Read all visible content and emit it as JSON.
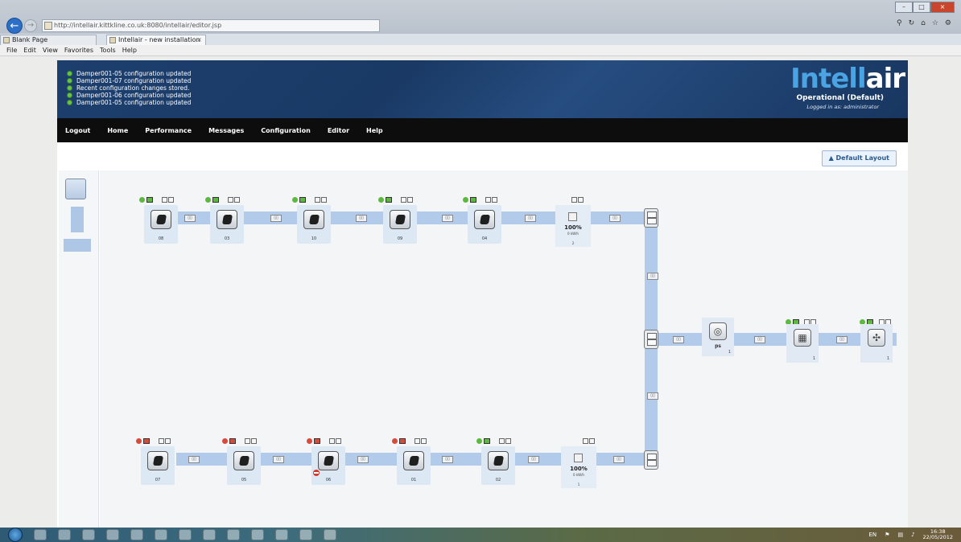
{
  "browser": {
    "url": "http://intellair.kittkline.co.uk:8080/intellair/editor.jsp",
    "tabs": [
      {
        "label": "Blank Page"
      },
      {
        "label": "Intellair - new installation"
      }
    ],
    "menu": [
      "File",
      "Edit",
      "View",
      "Favorites",
      "Tools",
      "Help"
    ],
    "tab_close": "×"
  },
  "header": {
    "messages": [
      "Damper001-05 configuration updated",
      "Damper001-07 configuration updated",
      "Recent configuration changes stored.",
      "Damper001-06 configuration updated",
      "Damper001-05 configuration updated"
    ],
    "logo_light": "Intell",
    "logo_bold": "air",
    "mode": "Operational (Default)",
    "logged_in": "Logged in as: administrator"
  },
  "nav": [
    "Logout",
    "Home",
    "Performance",
    "Messages",
    "Configuration",
    "Editor",
    "Help"
  ],
  "toolbar": {
    "default_layout_label": "Default Layout",
    "default_layout_icon": "warning-icon"
  },
  "diagram": {
    "top_row_labels": [
      "08",
      "03",
      "10",
      "09",
      "04"
    ],
    "bottom_row_labels": [
      "07",
      "05",
      "06",
      "01",
      "02"
    ],
    "top_meter": {
      "percent": "100%",
      "unit": "0 kW/h",
      "id": "2"
    },
    "bottom_meter": {
      "percent": "100%",
      "unit": "0 kW/h",
      "id": "1"
    },
    "pressure_sensor": {
      "name": "ps",
      "id": "1"
    },
    "filter_unit": {
      "id": "1"
    },
    "fan_unit": {
      "id": "1"
    }
  },
  "taskbar": {
    "lang": "EN",
    "time": "16:38",
    "date": "22/05/2012"
  }
}
